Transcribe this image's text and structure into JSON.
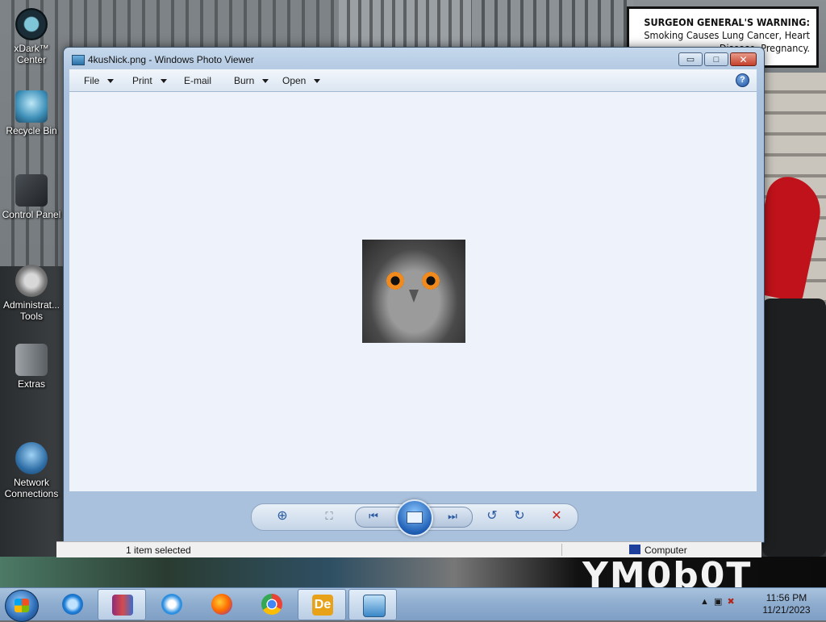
{
  "desktop": {
    "icons": [
      {
        "label": "xDark™\nCenter"
      },
      {
        "label": "Recycle Bin"
      },
      {
        "label": "Control Panel"
      },
      {
        "label": "Administrat...\nTools"
      },
      {
        "label": "Extras"
      },
      {
        "label": "Network\nConnections"
      }
    ],
    "wallpaper_warning": {
      "bold": "SURGEON GENERAL'S WARNING:",
      "text": "Smoking Causes Lung Cancer, Heart Disease, Pregnancy."
    },
    "wallpaper_bigtext": "YM0b0T"
  },
  "window": {
    "title": "4kusNick.png - Windows Photo Viewer",
    "buttons": {
      "minimize": "▭",
      "maximize": "□",
      "close": "✕"
    },
    "menu": {
      "file": "File",
      "print": "Print",
      "email": "E-mail",
      "burn": "Burn",
      "open": "Open",
      "help": "?"
    },
    "controls": {
      "zoom": "⊕",
      "actual_size": "⛶",
      "previous": "⏮",
      "next": "⏭",
      "rotate_ccw": "↺",
      "rotate_cw": "↻",
      "delete": "✕"
    }
  },
  "statusbar": {
    "selection": "1 item selected",
    "location": "Computer"
  },
  "taskbar": {
    "clock_time": "11:56 PM",
    "clock_date": "11/21/2023",
    "apps": [
      "winrar",
      "internet-explorer",
      "itunes",
      "firefox",
      "chrome",
      "dreamweaver",
      "photo-viewer"
    ],
    "accent": "#8eacce"
  }
}
